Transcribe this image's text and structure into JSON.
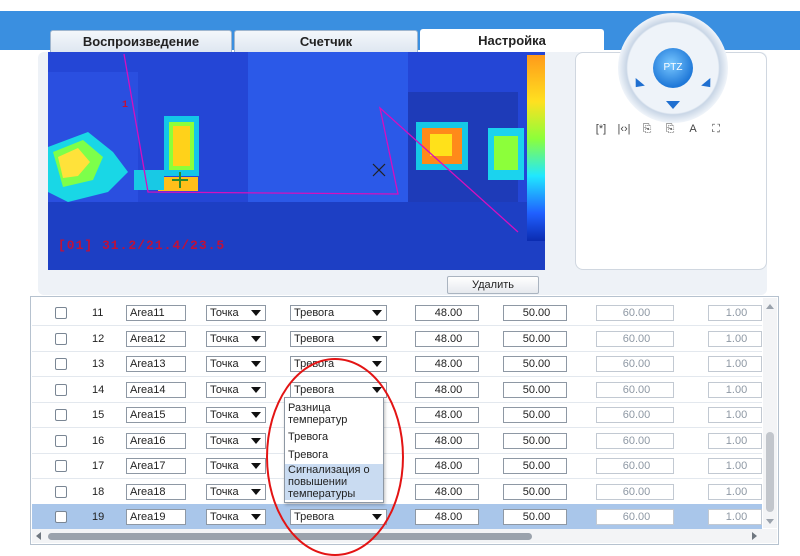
{
  "tabs": [
    {
      "label": "Воспроизведение"
    },
    {
      "label": "Счетчик"
    },
    {
      "label": "Настройка"
    }
  ],
  "video": {
    "osd_text": "[01] 31.2/21.4/23.5",
    "region_marker": "1"
  },
  "ptz": {
    "center_label": "PTZ",
    "tools": [
      "[*]",
      "|‹›|",
      "⎘",
      "⎘",
      "A",
      "⛶"
    ]
  },
  "actions": {
    "delete_label": "Удалить"
  },
  "table": {
    "rows": [
      {
        "num": "11",
        "name": "Area11",
        "type": "Точка",
        "alarm": "Тревога",
        "t1": "48.00",
        "t2": "50.00",
        "t3": "60.00",
        "t4": "1.00"
      },
      {
        "num": "12",
        "name": "Area12",
        "type": "Точка",
        "alarm": "Тревога",
        "t1": "48.00",
        "t2": "50.00",
        "t3": "60.00",
        "t4": "1.00"
      },
      {
        "num": "13",
        "name": "Area13",
        "type": "Точка",
        "alarm": "Тревога",
        "t1": "48.00",
        "t2": "50.00",
        "t3": "60.00",
        "t4": "1.00"
      },
      {
        "num": "14",
        "name": "Area14",
        "type": "Точка",
        "alarm": "Тревога",
        "t1": "48.00",
        "t2": "50.00",
        "t3": "60.00",
        "t4": "1.00"
      },
      {
        "num": "15",
        "name": "Area15",
        "type": "Точка",
        "alarm": "",
        "t1": "48.00",
        "t2": "50.00",
        "t3": "60.00",
        "t4": "1.00"
      },
      {
        "num": "16",
        "name": "Area16",
        "type": "Точка",
        "alarm": "",
        "t1": "48.00",
        "t2": "50.00",
        "t3": "60.00",
        "t4": "1.00"
      },
      {
        "num": "17",
        "name": "Area17",
        "type": "Точка",
        "alarm": "",
        "t1": "48.00",
        "t2": "50.00",
        "t3": "60.00",
        "t4": "1.00"
      },
      {
        "num": "18",
        "name": "Area18",
        "type": "Точка",
        "alarm": "",
        "t1": "48.00",
        "t2": "50.00",
        "t3": "60.00",
        "t4": "1.00"
      },
      {
        "num": "19",
        "name": "Area19",
        "type": "Точка",
        "alarm": "Тревога",
        "t1": "48.00",
        "t2": "50.00",
        "t3": "60.00",
        "t4": "1.00"
      }
    ]
  },
  "dropdown": {
    "options": [
      {
        "label": "Разница температур"
      },
      {
        "label": "Тревога"
      },
      {
        "label": "Тревога"
      },
      {
        "label": "Сигнализация о повышении температуры"
      }
    ]
  },
  "colors": {
    "header_blue": "#3a8fe0",
    "selected_row": "#a9c6ea",
    "highlight_option": "#c9dbf1",
    "annotation_red": "#e31414"
  }
}
